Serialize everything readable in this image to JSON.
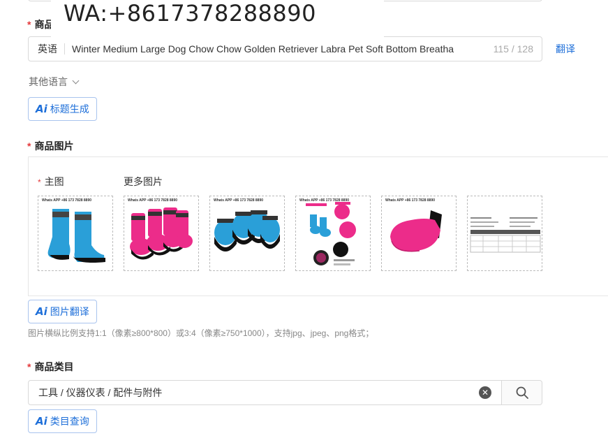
{
  "watermark": "WA:+8617378288890",
  "title_section": {
    "label": "商品",
    "lang": "英语",
    "value": "Winter Medium Large Dog Chow Chow Golden Retriever Labra Pet Soft Bottom Breatha",
    "count": "115 / 128",
    "translate": "翻译",
    "other_lang": "其他语言",
    "ai_button": "标题生成"
  },
  "images_section": {
    "label": "商品图片",
    "main_label": "主图",
    "more_label": "更多图片",
    "thumb_watermark": "Whats APP +86 173 7828 8890",
    "ai_button": "图片翻译",
    "hint": "图片横纵比例支持1:1（像素≥800*800）或3:4（像素≥750*1000），支持jpg、jpeg、png格式；"
  },
  "category_section": {
    "label": "商品类目",
    "value": "工具 / 仪器仪表 / 配件与附件",
    "ai_button": "类目查询"
  },
  "colors": {
    "required": "#e4393c",
    "accent": "#1e6fd9",
    "boot_blue": "#2a9fd8",
    "boot_pink": "#ec2c8a"
  },
  "ai_icon": "Ai"
}
